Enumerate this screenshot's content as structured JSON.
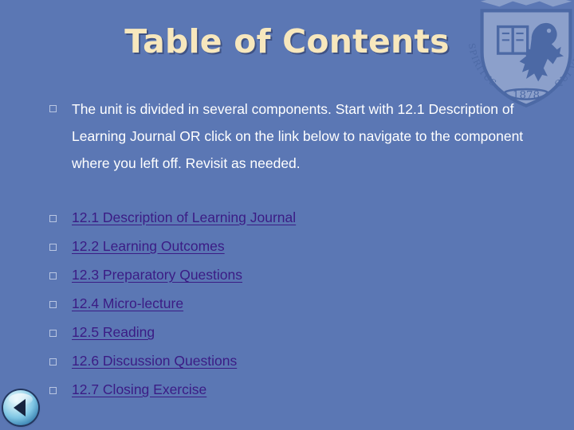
{
  "slide": {
    "title": "Table of Contents",
    "background_color": "#5B77B4",
    "title_color": "#F7E7BD",
    "body_text_color": "#FFFFFF",
    "link_color": "#3B1C85",
    "bullet_glyph": "square-outline"
  },
  "intro": {
    "bullet_name": "square-bullet",
    "text": "The unit is divided in several components. Start with 12.1 Description of Learning Journal OR click on the link below to navigate to the component where you left off. Revisit as needed."
  },
  "links": [
    {
      "label": "12.1 Description of Learning Journal"
    },
    {
      "label": "12.2 Learning Outcomes"
    },
    {
      "label": "12.3 Preparatory Questions"
    },
    {
      "label": "12.4 Micro-lecture"
    },
    {
      "label": "12.5 Reading"
    },
    {
      "label": "12.6 Discussion Questions"
    },
    {
      "label": "12.7 Closing Exercise"
    }
  ],
  "logo": {
    "name": "university-crest-watermark",
    "founded_year": "1878",
    "motto_left": "SPIRITUS EST",
    "motto_right": "QUI VIVIFICAT"
  },
  "navigation": {
    "back_button_name": "back-navigation-button",
    "back_icon": "left-triangle-icon"
  }
}
